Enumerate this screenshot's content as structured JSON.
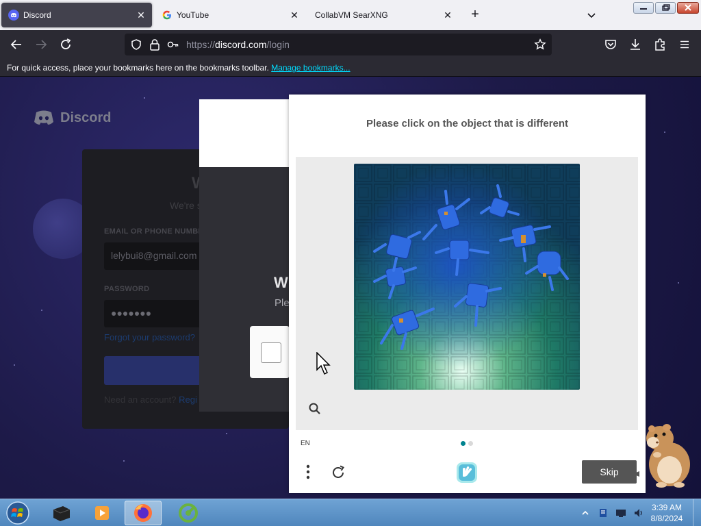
{
  "browser": {
    "tabs": [
      {
        "title": "Discord",
        "icon": "discord-icon",
        "active": true
      },
      {
        "title": "YouTube",
        "icon": "google-icon",
        "active": false
      },
      {
        "title": "CollabVM SearXNG",
        "icon": "",
        "active": false
      }
    ],
    "url_prefix": "https://",
    "url_host": "discord.com",
    "url_path": "/login",
    "bookmarks_message": "For quick access, place your bookmarks here on the bookmarks toolbar.",
    "bookmarks_link": "Manage bookmarks..."
  },
  "discord": {
    "brand": "Discord",
    "title_partial": "W",
    "subtitle_partial": "We're s",
    "email_label": "EMAIL OR PHONE NUMBE",
    "email_value": "lelybui8@gmail.com",
    "password_label": "PASSWORD",
    "password_value": "●●●●●●●",
    "forgot_link": "Forgot your password?",
    "need_account": "Need an account?",
    "register_link": "Regi",
    "modal_title_partial": "W",
    "modal_subtitle_partial": "Ple"
  },
  "captcha": {
    "prompt": "Please click on the object that is different",
    "language": "EN",
    "skip_label": "Skip",
    "page_index": 1,
    "page_count": 2,
    "accent_color": "#00838f",
    "inactive_dot_color": "#d9d9d9"
  },
  "taskbar": {
    "time": "3:39 AM",
    "date": "8/8/2024"
  }
}
